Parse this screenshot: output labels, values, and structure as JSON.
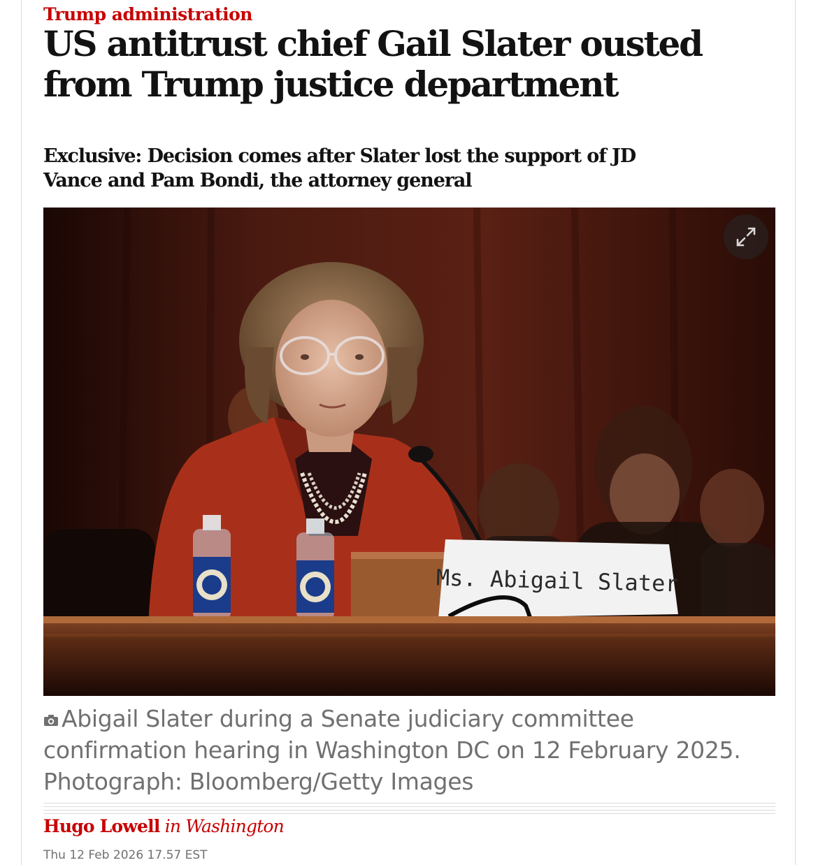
{
  "article": {
    "kicker": "Trump administration",
    "headline": "US antitrust chief Gail Slater ousted from Trump justice department",
    "standfirst": "Exclusive: Decision comes after Slater lost the support of JD Vance and Pam Bondi, the attorney general",
    "image": {
      "nameplate_text": "Ms. Abigail Slater",
      "expand_icon": "expand-arrows-icon"
    },
    "caption": {
      "icon": "camera-icon",
      "text": "Abigail Slater during a Senate judiciary committee confirmation hearing in Washington DC on 12 February 2025. Photograph: Bloomberg/Getty Images"
    },
    "byline": {
      "author": "Hugo Lowell",
      "location": "in Washington"
    },
    "dateline": "Thu 12 Feb 2026 17.57 EST"
  },
  "colors": {
    "accent": "#c70000",
    "text": "#121212",
    "muted": "#707070",
    "rule": "#dcdcdc"
  }
}
